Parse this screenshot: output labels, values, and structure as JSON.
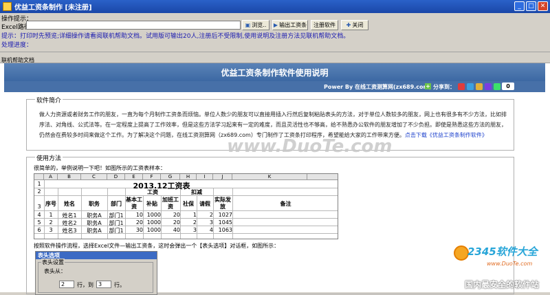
{
  "window": {
    "title": "优益工资条制作 [未注册]"
  },
  "toolbar": {
    "ops_label": "操作提示：",
    "excel_label": "Excel路径",
    "excel_path": "",
    "browse": "浏览..",
    "export": "输出工资条",
    "register": "注册软件",
    "close": "关闭"
  },
  "tip": "提示：打印时先预览;详细操作请看阅联机帮助文档。试用版可输出20人,注册后不受限制,使用说明及注册方法见联机帮助文档。",
  "progress_label": "处理进度：",
  "help_tab": "联机帮助文档",
  "doc": {
    "title": "优益工资条制作软件使用说明",
    "power": "Power By 在线工资测算网(zx689.com)",
    "share": "分享到：",
    "share_count": "0",
    "intro_title": "软件简介",
    "intro_text": "做人力资源或者财务工作的朋友，一直为每个月制作工资条而烦恼。单位人数少的朋友可以直接用插入行然后复制粘贴表头的方法，对于单位人数较多的朋友，网上也有很多有不少方法，比如排序法、对角线、公式法等。在一定程度上提高了工作效率，但是这些方法学习起来有一定的难度，而且灵活性也不够高，给不熟悉办公软件的朋友增加了不少负担。即使是熟悉这些方法的朋友，仍然会在费较多时间来做这个工作。为了解决这个问题，在线工资测算网（zx689.com）专门制作了工资条打印程序，希望能给大家的工作带来方便。",
    "download_link": "点击下载《优益工资条制作软件》",
    "usage_title": "使用方法",
    "usage_intro": "很简单的，举例说明一下吧！如图所示的工资表样本：",
    "steps": "按照软件操作流程，选择Excel文件—输出工资条，这时会弹出一个【表头选项】对话框，如图所示：",
    "dialog_title": "表头选项",
    "dialog_group": "表头设置",
    "header_from": "表头从：",
    "row_from": "2",
    "row_to": "3",
    "row_word": "行，到",
    "row_end": "行。"
  },
  "sheet": {
    "cols": [
      "",
      "A",
      "B",
      "C",
      "D",
      "E",
      "F",
      "G",
      "H",
      "I",
      "J",
      "K"
    ],
    "title": "2013.12工资表",
    "row_nums": [
      "1",
      "2",
      "3",
      "4",
      "5",
      "6"
    ],
    "h_seq": "序号",
    "h_name": "姓名",
    "h_post": "职务",
    "h_dept": "部门",
    "h_wage": "工资",
    "h_base": "基本工资",
    "h_sub": "补贴",
    "h_ot": "加班工资",
    "h_deduct": "扣减",
    "h_ss": "社保",
    "h_leave": "请假",
    "h_actual": "实际发放",
    "h_note": "备注",
    "rows": [
      [
        "1",
        "姓名1",
        "职务A",
        "部门1",
        "10",
        "1000",
        "20",
        "1",
        "2",
        "1027"
      ],
      [
        "2",
        "姓名2",
        "职务A",
        "部门1",
        "20",
        "1000",
        "20",
        "2",
        "3",
        "1045"
      ],
      [
        "3",
        "姓名3",
        "职务A",
        "部门1",
        "30",
        "1000",
        "40",
        "3",
        "4",
        "1063"
      ]
    ]
  },
  "watermark": "www.DuoTe.com",
  "brand": {
    "name": "2345软件大全",
    "url": "www.DuoTe.com",
    "slogan": "国内最安全的软件站"
  }
}
